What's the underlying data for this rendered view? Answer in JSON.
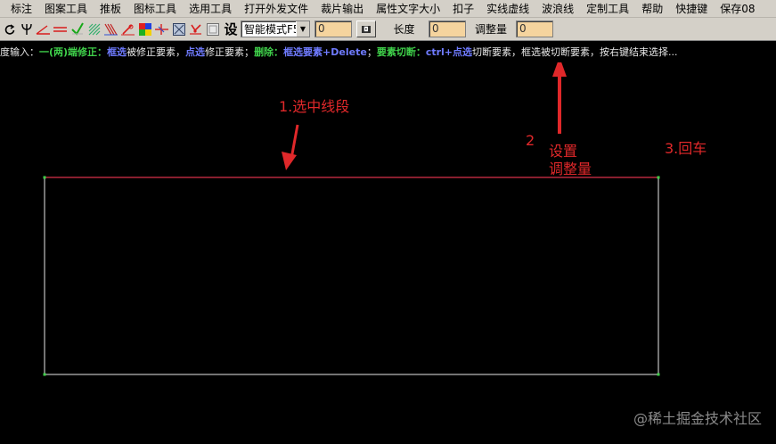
{
  "menu": {
    "items": [
      "标注",
      "图案工具",
      "推板",
      "图标工具",
      "选用工具",
      "打开外发文件",
      "裁片输出",
      "属性文字大小",
      "扣子",
      "实线虚线",
      "波浪线",
      "定制工具",
      "帮助",
      "快捷键",
      "保存08"
    ]
  },
  "toolbar": {
    "icons": [
      "rotate-icon",
      "psi-icon",
      "angle-line-icon",
      "double-line-icon",
      "green-check-icon",
      "hatch-icon",
      "pleat-icon",
      "pen-icon",
      "color-swatch-icon",
      "split-icon",
      "frame-icon",
      "heart-arrow-icon",
      "grid-icon"
    ],
    "set_button": "设",
    "mode": "智能模式F5",
    "input1": "0",
    "length_label": "长度",
    "length_value": "0",
    "adjust_label": "调整量",
    "adjust_value": "0"
  },
  "hint": {
    "parts": [
      {
        "text": "度输入：",
        "style": "white"
      },
      {
        "text": "一(两)端修正：",
        "style": "green"
      },
      {
        "text": "框选",
        "style": "blue"
      },
      {
        "text": "被修正要素，",
        "style": "white"
      },
      {
        "text": "点选",
        "style": "blue"
      },
      {
        "text": "修正要素；",
        "style": "white"
      },
      {
        "text": "删除：",
        "style": "green"
      },
      {
        "text": "框选要素+Delete",
        "style": "blue"
      },
      {
        "text": "；",
        "style": "white"
      },
      {
        "text": "要素切断：",
        "style": "green"
      },
      {
        "text": "ctrl+点选",
        "style": "blue"
      },
      {
        "text": "切断要素，框选被切断要素，按右键结束选择...",
        "style": "white"
      }
    ]
  },
  "annotations": {
    "step1": "1.选中线段",
    "step2_num": "2",
    "step2_line1": "设置",
    "step2_line2": "调整量",
    "step3": "3.回车"
  },
  "watermark": "@稀土掘金技术社区",
  "colors": {
    "annotation": "#e0282a",
    "selected_line": "#d9304a",
    "rect_outline": "#e8e8e8",
    "hint_green": "#3fd04a",
    "hint_blue": "#6f7bff",
    "input_bg": "#f5d49e"
  }
}
